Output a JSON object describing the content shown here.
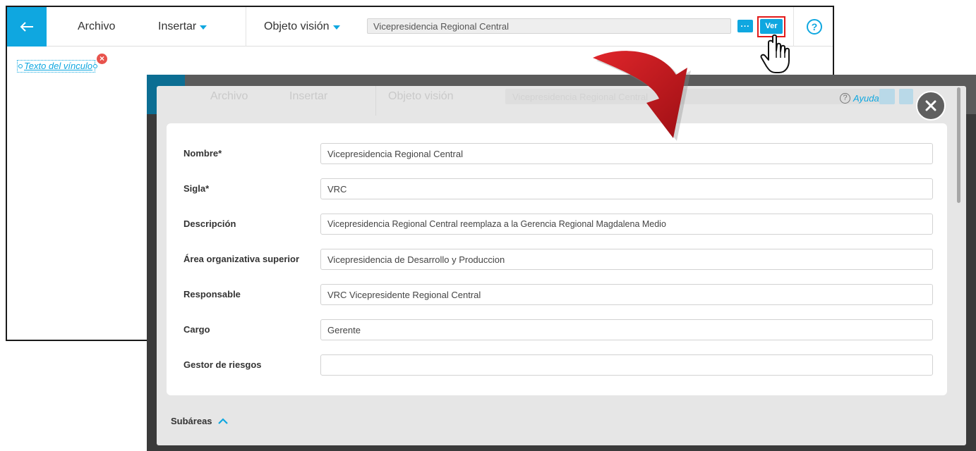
{
  "toolbar": {
    "archivo": "Archivo",
    "insertar": "Insertar",
    "objeto_vision": "Objeto visión",
    "selected_area": "Vicepresidencia Regional Central",
    "more_label": "...",
    "ver_label": "Ver",
    "help_label": "?"
  },
  "canvas": {
    "link_text": "Texto del vínculo",
    "remove_label": "×"
  },
  "dialog": {
    "ayuda_label": "Ayuda",
    "ayuda_icon": "?",
    "fields": [
      {
        "label": "Nombre*",
        "value": "Vicepresidencia Regional Central"
      },
      {
        "label": "Sigla*",
        "value": "VRC"
      },
      {
        "label": "Descripción",
        "value": "Vicepresidencia Regional Central reemplaza a la Gerencia Regional Magdalena Medio"
      },
      {
        "label": "Área organizativa superior",
        "value": "Vicepresidencia de Desarrollo y Produccion"
      },
      {
        "label": "Responsable",
        "value": "VRC Vicepresidente Regional Central"
      },
      {
        "label": "Cargo",
        "value": "Gerente"
      },
      {
        "label": "Gestor de riesgos",
        "value": ""
      }
    ],
    "subareas_label": "Subáreas"
  },
  "ghost_toolbar": {
    "archivo": "Archivo",
    "insertar": "Insertar",
    "objeto_vision": "Objeto visión",
    "selected_area": "Vicepresidencia Regional Central"
  },
  "colors": {
    "accent": "#0fa7e0",
    "highlight_box": "#e21a1a",
    "arrow": "#c8161b",
    "overlay": "#3a3a3a"
  }
}
